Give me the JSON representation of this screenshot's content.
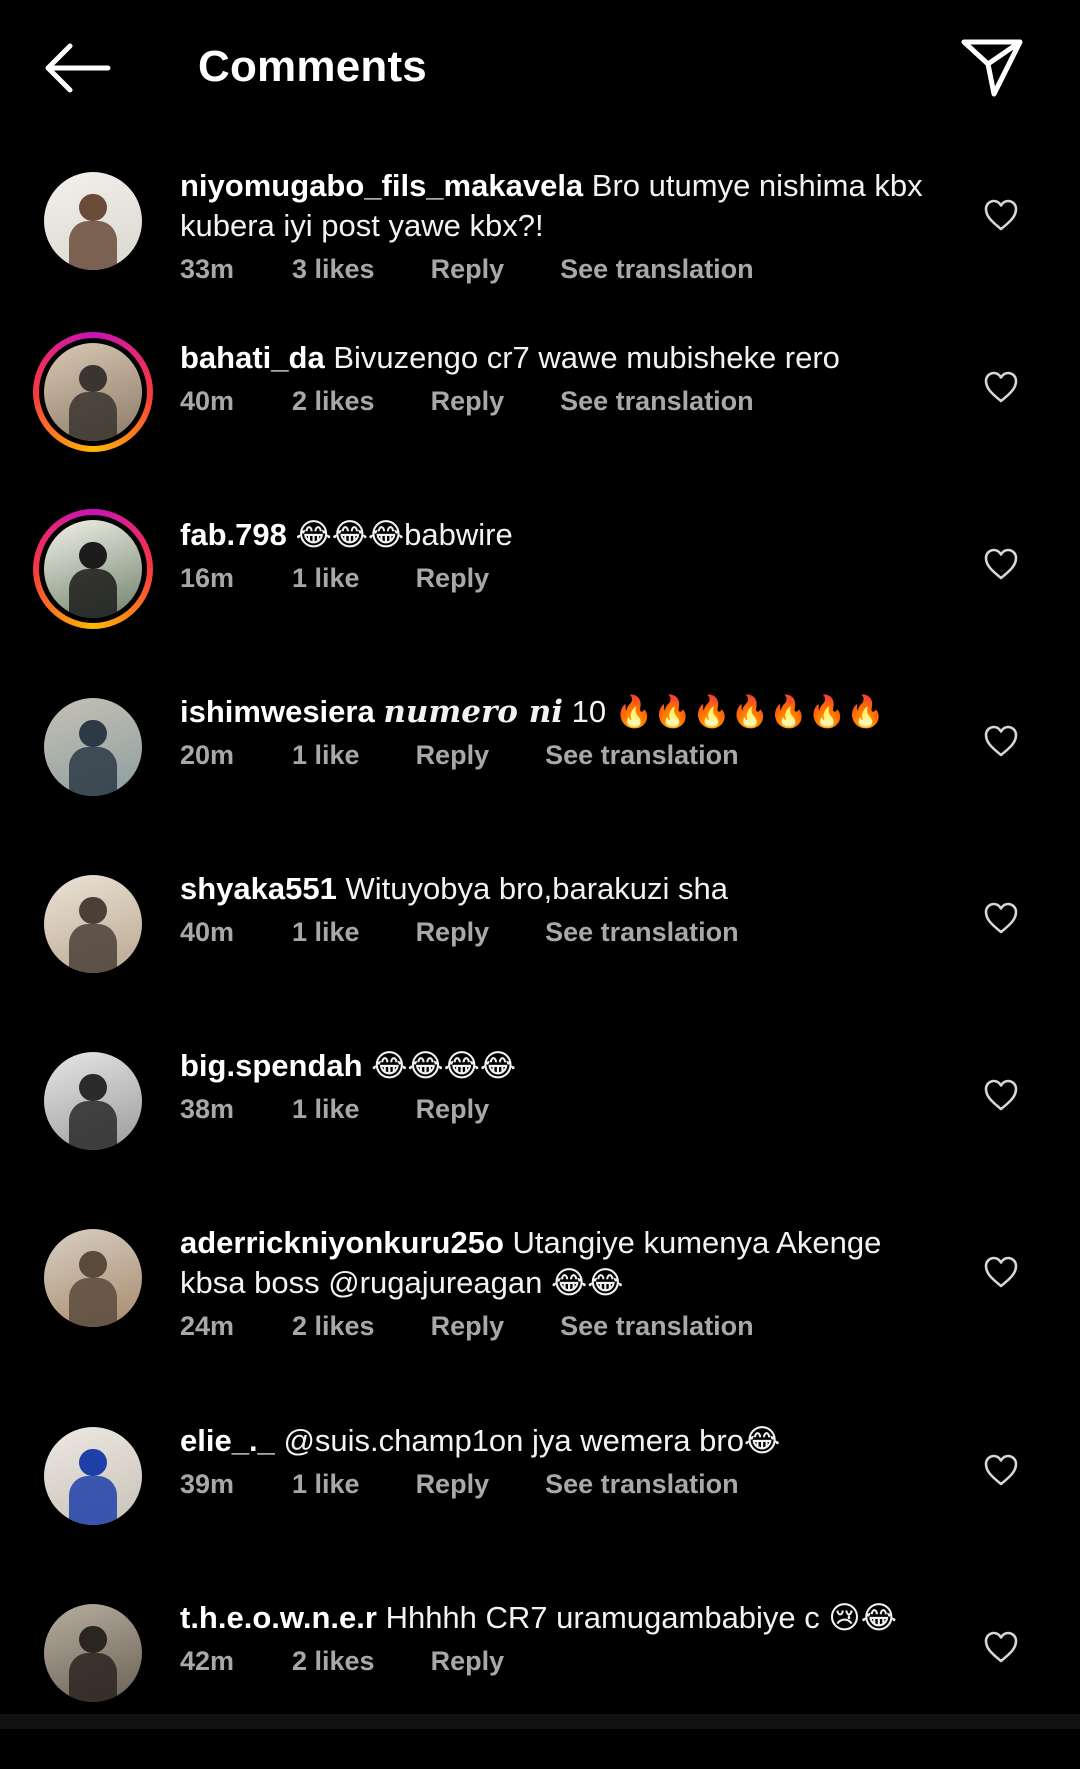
{
  "header": {
    "title": "Comments",
    "back_icon": "arrow-left-icon",
    "send_icon": "send-paper-plane-icon"
  },
  "comments": [
    {
      "username": "niyomugabo_fils_makavela",
      "text": "Bro utumye nishima kbx kubera iyi post yawe kbx?!",
      "time": "33m",
      "likes": "3 likes",
      "reply": "Reply",
      "translate": "See translation",
      "story": false
    },
    {
      "username": "bahati_da",
      "text": "Bivuzengo cr7 wawe mubisheke rero",
      "time": "40m",
      "likes": "2 likes",
      "reply": "Reply",
      "translate": "See translation",
      "story": true
    },
    {
      "username": "fab.798",
      "text": "😂😂😂babwire",
      "time": "16m",
      "likes": "1 like",
      "reply": "Reply",
      "translate": "",
      "story": true
    },
    {
      "username": "ishimwesiera",
      "text_italic": "numero ni",
      "text": " 10 🔥🔥🔥🔥🔥🔥🔥",
      "time": "20m",
      "likes": "1 like",
      "reply": "Reply",
      "translate": "See translation",
      "story": false
    },
    {
      "username": "shyaka551",
      "text": "Wituyobya bro,barakuzi sha",
      "time": "40m",
      "likes": "1 like",
      "reply": "Reply",
      "translate": "See translation",
      "story": false
    },
    {
      "username": "big.spendah",
      "text": "😂😂😂😂",
      "time": "38m",
      "likes": "1 like",
      "reply": "Reply",
      "translate": "",
      "story": false
    },
    {
      "username": "aderrickniyonkuru25o",
      "text": "Utangiye kumenya Akenge kbsa boss @rugajureagan 😂😂",
      "time": "24m",
      "likes": "2 likes",
      "reply": "Reply",
      "translate": "See translation",
      "story": false
    },
    {
      "username": "elie_._",
      "text": "@suis.champ1on jya wemera bro😂",
      "time": "39m",
      "likes": "1 like",
      "reply": "Reply",
      "translate": "See translation",
      "story": false
    },
    {
      "username": "t.h.e.o.w.n.e.r",
      "text": "Hhhhh CR7 uramugambabiye c 😢😂",
      "time": "42m",
      "likes": "2 likes",
      "reply": "Reply",
      "translate": "",
      "story": false
    }
  ]
}
